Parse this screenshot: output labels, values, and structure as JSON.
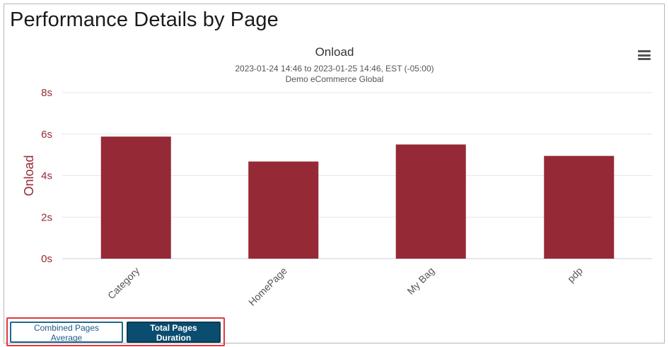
{
  "page": {
    "title": "Performance Details by Page"
  },
  "chart_menu": {
    "icon": "hamburger-menu-icon"
  },
  "chart_data": {
    "type": "bar",
    "title": "Onload",
    "subtitle": "2023-01-24 14:46 to 2023-01-25 14:46, EST (-05:00)",
    "subtitle2": "Demo eCommerce Global",
    "ylabel": "Onload",
    "xlabel": "",
    "categories": [
      "Category",
      "HomePage",
      "My Bag",
      "pdp"
    ],
    "values": [
      5.88,
      4.68,
      5.5,
      4.95
    ],
    "ylim": [
      0,
      8
    ],
    "yticks": [
      0,
      2,
      4,
      6,
      8
    ],
    "ytick_labels": [
      "0s",
      "2s",
      "4s",
      "6s",
      "8s"
    ],
    "grid": true,
    "legend": "none",
    "bar_color": "#962936",
    "axis_color": "#962936"
  },
  "buttons": {
    "combined_label": "Combined Pages Average",
    "total_label": "Total Pages Duration"
  },
  "colors": {
    "highlight": "#e0393e",
    "button_primary": "#0b4d6f"
  }
}
